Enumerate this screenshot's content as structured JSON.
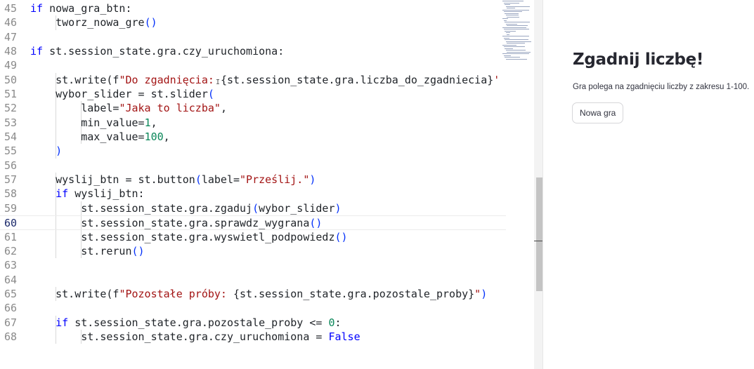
{
  "editor": {
    "lines": [
      {
        "n": "45",
        "indent": 0,
        "tokens": [
          {
            "t": "if",
            "c": "kw"
          },
          {
            "t": " nowa_gra_btn:"
          }
        ]
      },
      {
        "n": "46",
        "indent": 1,
        "tokens": [
          {
            "t": "    tworz_nowa_gre"
          },
          {
            "t": "()",
            "c": "bl"
          }
        ]
      },
      {
        "n": "47",
        "indent": 0,
        "tokens": []
      },
      {
        "n": "48",
        "indent": 0,
        "tokens": [
          {
            "t": "if",
            "c": "kw"
          },
          {
            "t": " st.session_state.gra.czy_uruchomiona:"
          }
        ]
      },
      {
        "n": "49",
        "indent": 0,
        "tokens": []
      },
      {
        "n": "50",
        "indent": 1,
        "tokens": [
          {
            "t": "    st.write(f"
          },
          {
            "t": "\"Do zgadnięcia: ",
            "c": "str"
          },
          {
            "t": "{st.session_state.gra.liczba_do_zgadniecia}"
          },
          {
            "t": "'",
            "c": "str"
          }
        ]
      },
      {
        "n": "51",
        "indent": 1,
        "tokens": [
          {
            "t": "    wybor_slider = st.slider"
          },
          {
            "t": "(",
            "c": "bl"
          }
        ]
      },
      {
        "n": "52",
        "indent": 2,
        "tokens": [
          {
            "t": "        label="
          },
          {
            "t": "\"Jaka to liczba\"",
            "c": "str"
          },
          {
            "t": ","
          }
        ]
      },
      {
        "n": "53",
        "indent": 2,
        "tokens": [
          {
            "t": "        min_value="
          },
          {
            "t": "1",
            "c": "num"
          },
          {
            "t": ","
          }
        ]
      },
      {
        "n": "54",
        "indent": 2,
        "tokens": [
          {
            "t": "        max_value="
          },
          {
            "t": "100",
            "c": "num"
          },
          {
            "t": ","
          }
        ]
      },
      {
        "n": "55",
        "indent": 1,
        "tokens": [
          {
            "t": "    "
          },
          {
            "t": ")",
            "c": "bl"
          }
        ]
      },
      {
        "n": "56",
        "indent": 0,
        "tokens": []
      },
      {
        "n": "57",
        "indent": 1,
        "tokens": [
          {
            "t": "    wyslij_btn = st.button"
          },
          {
            "t": "(",
            "c": "bl"
          },
          {
            "t": "label="
          },
          {
            "t": "\"Prześlij.\"",
            "c": "str"
          },
          {
            "t": ")",
            "c": "bl"
          }
        ]
      },
      {
        "n": "58",
        "indent": 1,
        "tokens": [
          {
            "t": "    "
          },
          {
            "t": "if",
            "c": "kw"
          },
          {
            "t": " wyslij_btn:"
          }
        ]
      },
      {
        "n": "59",
        "indent": 2,
        "tokens": [
          {
            "t": "        st.session_state.gra.zgaduj"
          },
          {
            "t": "(",
            "c": "bl"
          },
          {
            "t": "wybor_slider"
          },
          {
            "t": ")",
            "c": "bl"
          }
        ]
      },
      {
        "n": "60",
        "indent": 2,
        "current": true,
        "tokens": [
          {
            "t": "        st.session_state.gra.sprawdz_wygrana"
          },
          {
            "t": "()",
            "c": "bl"
          }
        ]
      },
      {
        "n": "61",
        "indent": 2,
        "tokens": [
          {
            "t": "        st.session_state.gra.wyswietl_podpowiedz"
          },
          {
            "t": "()",
            "c": "bl"
          }
        ]
      },
      {
        "n": "62",
        "indent": 2,
        "tokens": [
          {
            "t": "        st.rerun"
          },
          {
            "t": "()",
            "c": "bl"
          }
        ]
      },
      {
        "n": "63",
        "indent": 0,
        "tokens": []
      },
      {
        "n": "64",
        "indent": 0,
        "tokens": []
      },
      {
        "n": "65",
        "indent": 1,
        "tokens": [
          {
            "t": "    st.write(f"
          },
          {
            "t": "\"Pozostałe próby: ",
            "c": "str"
          },
          {
            "t": "{st.session_state.gra.pozostale_proby}"
          },
          {
            "t": "\"",
            "c": "str"
          },
          {
            "t": ")",
            "c": "bl"
          }
        ]
      },
      {
        "n": "66",
        "indent": 0,
        "tokens": []
      },
      {
        "n": "67",
        "indent": 1,
        "tokens": [
          {
            "t": "    "
          },
          {
            "t": "if",
            "c": "kw"
          },
          {
            "t": " st.session_state.gra.pozostale_proby <= "
          },
          {
            "t": "0",
            "c": "num"
          },
          {
            "t": ":"
          }
        ]
      },
      {
        "n": "68",
        "indent": 2,
        "tokens": [
          {
            "t": "        st.session_state.gra.czy_uruchomiona = "
          },
          {
            "t": "False",
            "c": "kw"
          }
        ]
      }
    ]
  },
  "app": {
    "title": "Zgadnij liczbę!",
    "description": "Gra polega na zgadnięciu liczby z zakresu 1-100.",
    "new_game_button": "Nowa gra"
  },
  "colors": {
    "keyword": "#0000ff",
    "string": "#a31515",
    "number": "#098658",
    "bracket": "#0431fa"
  }
}
